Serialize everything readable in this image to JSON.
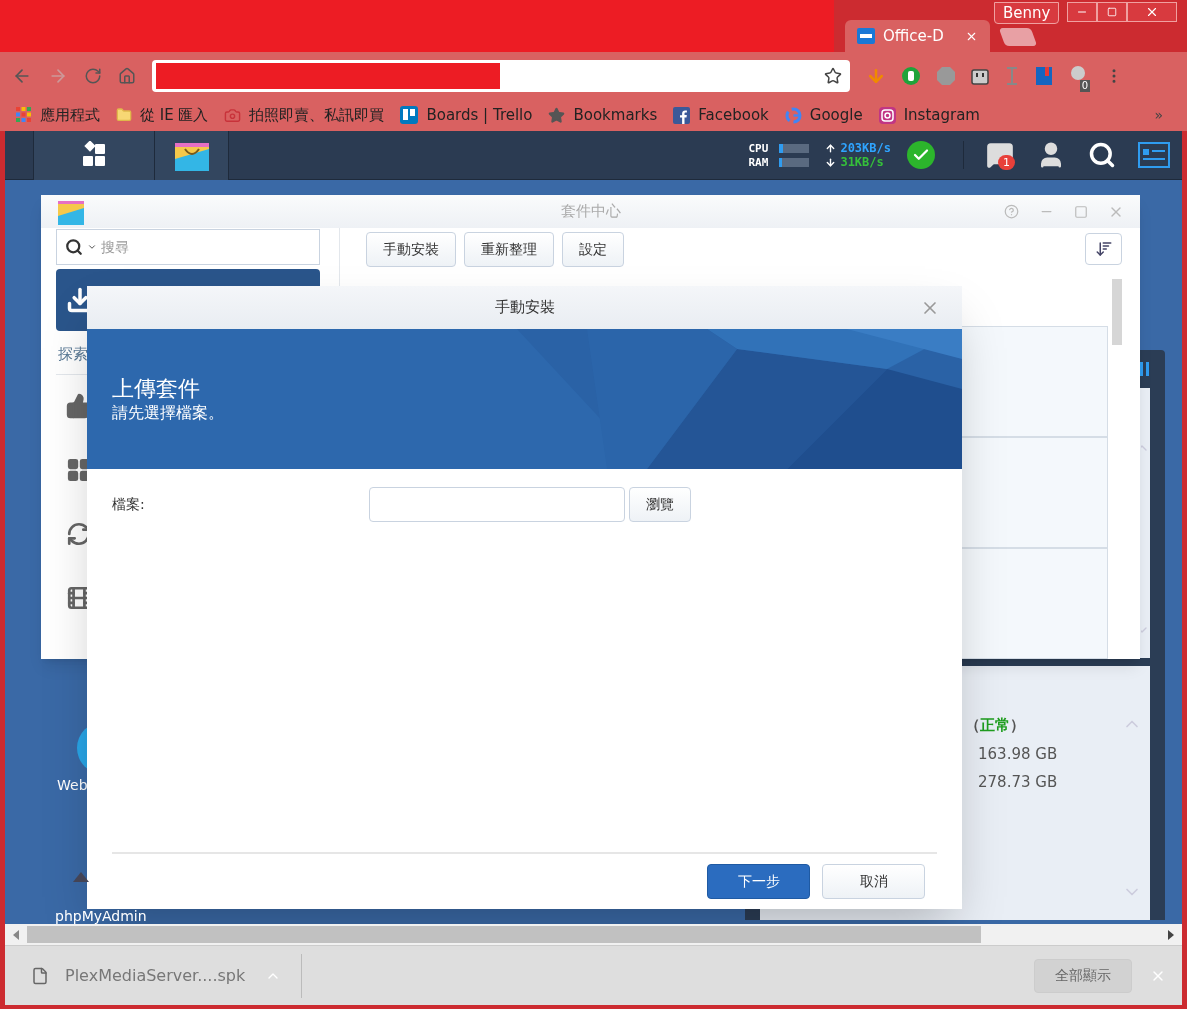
{
  "browser": {
    "profile": "Benny",
    "tabs": [
      {
        "title": "Office-D",
        "selected": true
      }
    ],
    "extension_badge": "0",
    "bookmarks": [
      {
        "label": "應用程式",
        "kind": "apps"
      },
      {
        "label": "從 IE 匯入",
        "kind": "folder"
      },
      {
        "label": "拍照即賣、私訊即買",
        "kind": "camera"
      },
      {
        "label": "Boards | Trello",
        "kind": "trello"
      },
      {
        "label": "Bookmarks",
        "kind": "star"
      },
      {
        "label": "Facebook",
        "kind": "facebook"
      },
      {
        "label": "Google",
        "kind": "google"
      },
      {
        "label": "Instagram",
        "kind": "instagram"
      }
    ],
    "overflow": "»"
  },
  "taskbar": {
    "meters": [
      {
        "label": "CPU",
        "level": 0.12
      },
      {
        "label": "RAM",
        "level": 0.1
      }
    ],
    "upload": "203KB/s",
    "download": "31KB/s",
    "notifications": "1"
  },
  "package_center": {
    "title": "套件中心",
    "search_placeholder": "搜尋",
    "buttons": [
      "手動安裝",
      "重新整理",
      "設定"
    ],
    "section": "探索"
  },
  "desktop_icons": [
    {
      "label": "Web"
    },
    {
      "label": "phpMyAdmin"
    }
  ],
  "widget": {
    "status_open": "（",
    "status": "正常",
    "status_close": "）",
    "lines": [
      "163.98 GB",
      "278.73 GB"
    ]
  },
  "dialog": {
    "title": "手動安裝",
    "heading": "上傳套件",
    "subheading": "請先選擇檔案。",
    "field_label": "檔案:",
    "browse": "瀏覽",
    "buttons": [
      {
        "label": "下一步",
        "kind": "primary"
      },
      {
        "label": "取消",
        "kind": "secondary"
      }
    ]
  },
  "downloads": {
    "file": "PlexMediaServer....spk",
    "show_all": "全部顯示"
  }
}
